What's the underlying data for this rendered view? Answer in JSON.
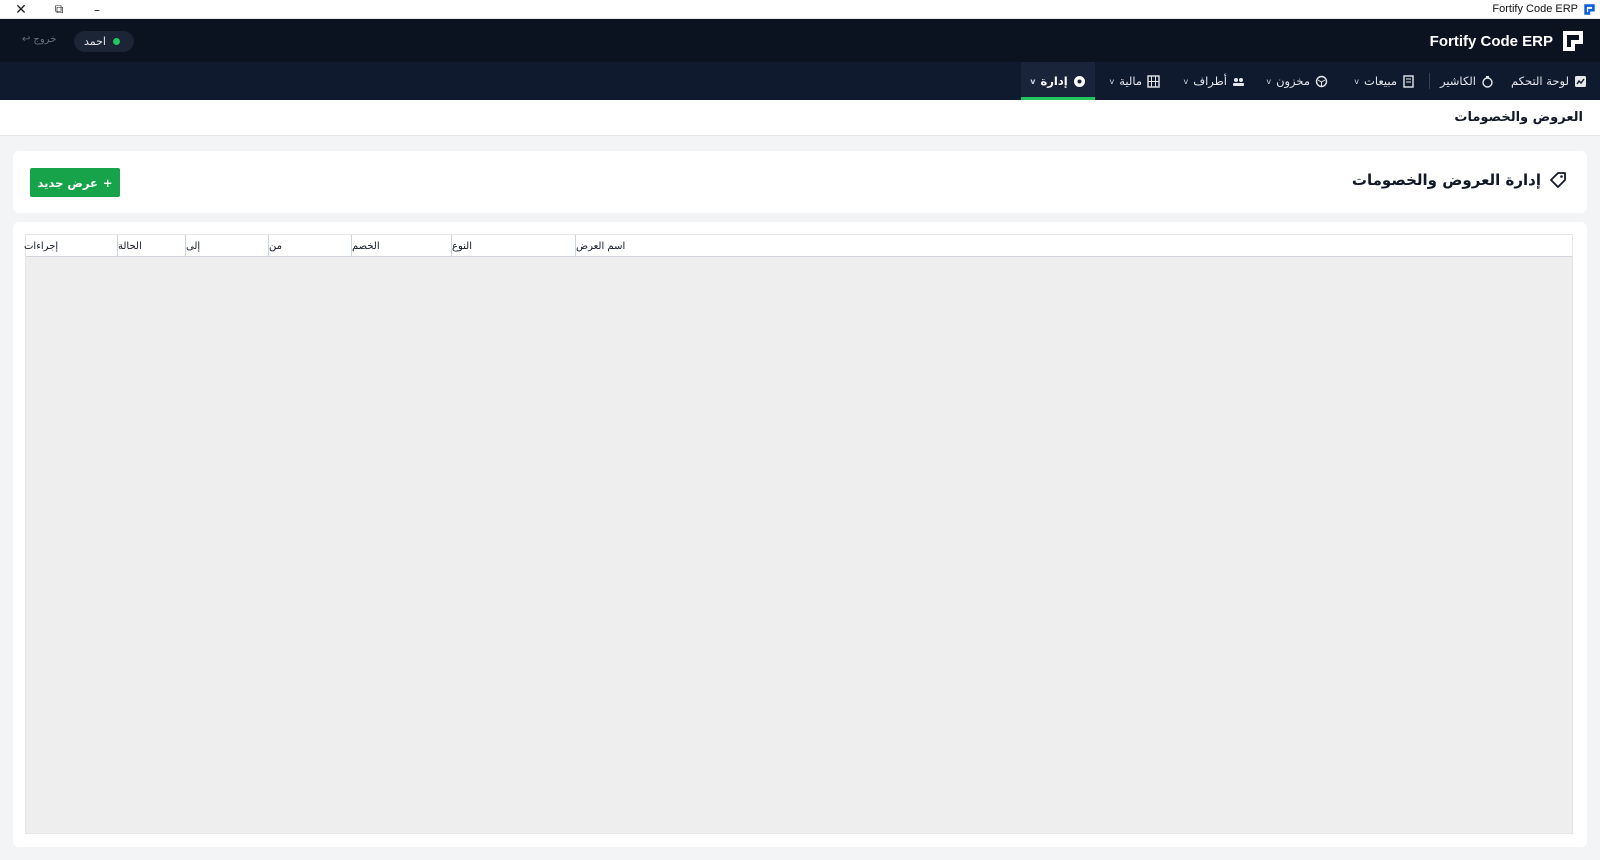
{
  "window": {
    "title": "Fortify Code ERP",
    "controls": {
      "close": "✕",
      "restore": "⧉",
      "minimize": "–"
    }
  },
  "header": {
    "brand": "Fortify Code ERP",
    "user": "احمد",
    "logout": "خروج",
    "logout_icon": "↩"
  },
  "nav": {
    "items": [
      {
        "label": "لوحة التحكم",
        "icon": "dashboard-icon",
        "dropdown": false
      },
      {
        "label": "الكاشير",
        "icon": "cashier-icon",
        "dropdown": false
      },
      {
        "label": "مبيعات",
        "icon": "receipt-icon",
        "dropdown": true
      },
      {
        "label": "مخزون",
        "icon": "box-icon",
        "dropdown": true
      },
      {
        "label": "أطراف",
        "icon": "people-icon",
        "dropdown": true
      },
      {
        "label": "مالية",
        "icon": "finance-icon",
        "dropdown": true
      },
      {
        "label": "إدارة",
        "icon": "gear-icon",
        "dropdown": true,
        "active": true
      }
    ],
    "chevron": "v"
  },
  "page": {
    "title": "العروض والخصومات"
  },
  "section": {
    "title": "إدارة العروض والخصومات",
    "new_button": "عرض جديد",
    "new_button_icon": "+"
  },
  "table": {
    "columns": [
      "اسم العرض",
      "النوع",
      "الخصم",
      "من",
      "إلى",
      "الحالة",
      "إجراءات"
    ],
    "rows": []
  },
  "colors": {
    "header_bg": "#0b1220",
    "nav_bg": "#0f1a2e",
    "accent": "#16a34a",
    "active_underline": "#22c55e"
  }
}
